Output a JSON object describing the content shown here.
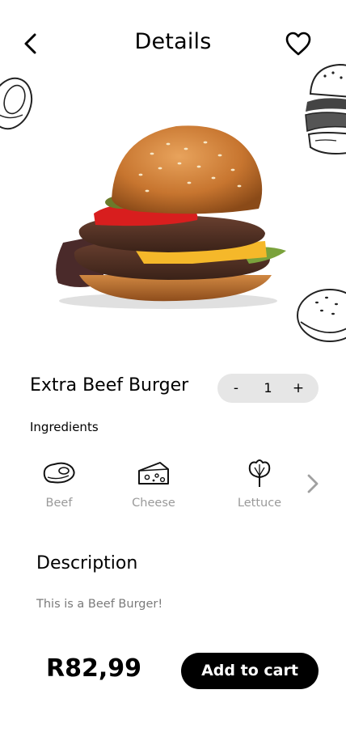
{
  "header": {
    "title": "Details",
    "back_icon": "chevron-left-icon",
    "favorite_icon": "heart-outline-icon"
  },
  "product": {
    "name": "Extra Beef Burger",
    "price": "R82,99",
    "quantity": {
      "minus_label": "-",
      "value": "1",
      "plus_label": "+"
    }
  },
  "ingredients": {
    "title": "Ingredients",
    "items": [
      {
        "label": "Beef",
        "icon": "steak-icon"
      },
      {
        "label": "Cheese",
        "icon": "cheese-icon"
      },
      {
        "label": "Lettuce",
        "icon": "lettuce-icon"
      }
    ],
    "next_icon": "chevron-right-icon"
  },
  "description": {
    "title": "Description",
    "text": "This is a Beef Burger!"
  },
  "actions": {
    "add_to_cart_label": "Add to cart"
  },
  "colors": {
    "primary": "#000000",
    "background": "#ffffff",
    "muted_text": "#9a9a9a",
    "pill_bg": "#e6e6e6"
  }
}
